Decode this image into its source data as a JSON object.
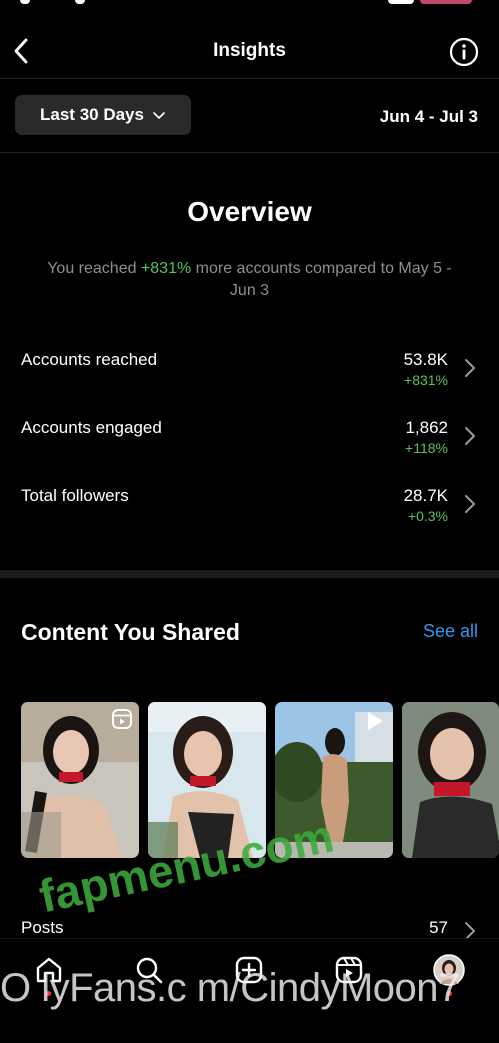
{
  "header": {
    "title": "Insights",
    "back_icon": "chevron-left-icon",
    "info_icon": "info-circle-icon"
  },
  "range": {
    "button_label": "Last 30 Days",
    "date_range": "Jun 4 - Jul 3"
  },
  "overview": {
    "title": "Overview",
    "sub_before": "You reached ",
    "sub_pct": "+831%",
    "sub_after": " more accounts compared to May 5 - Jun 3"
  },
  "metrics": [
    {
      "label": "Accounts reached",
      "value": "53.8K",
      "change": "+831%"
    },
    {
      "label": "Accounts engaged",
      "value": "1,862",
      "change": "+118%"
    },
    {
      "label": "Total followers",
      "value": "28.7K",
      "change": "+0.3%"
    }
  ],
  "content": {
    "title": "Content You Shared",
    "see_all": "See all"
  },
  "posts": {
    "label": "Posts",
    "value": "57"
  },
  "watermark": {
    "bottom": "O lyFans.c m/CindyMoon7",
    "diagonal": "fapmenu.com"
  },
  "colors": {
    "background": "#000000",
    "positive": "#58c35b",
    "link": "#3797f0",
    "button_bg": "#2a2a2a"
  }
}
